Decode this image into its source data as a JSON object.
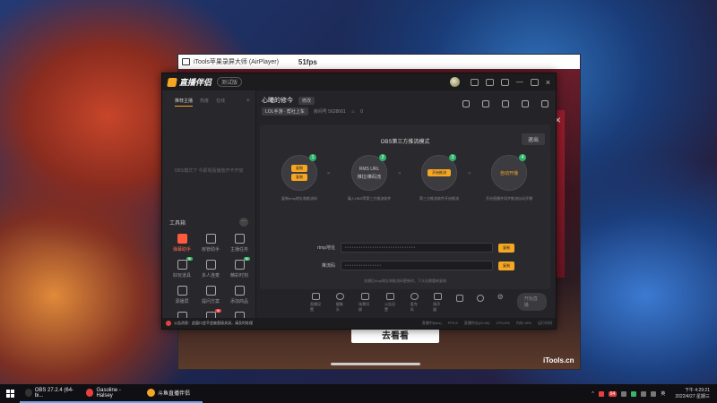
{
  "itools": {
    "title": "iTools苹果录屏大师 (AirPlayer)",
    "fps": "51fps",
    "go_look_button": "去看看",
    "brand": "iTools.cn"
  },
  "app": {
    "logo_text": "直播伴侣",
    "version": "测试版",
    "sidebar": {
      "tabs": [
        "推荐主播",
        "热度",
        "在线"
      ],
      "plus": "+",
      "empty_text": "OBS模式下 今即观看播放开不开放",
      "toolbox_title": "工具箱",
      "toolbox_more": "···",
      "tools": [
        {
          "label": "弹幕助手",
          "hot": true,
          "tag": ""
        },
        {
          "label": "房管助手",
          "hot": false,
          "tag": ""
        },
        {
          "label": "主播任务",
          "hot": false,
          "tag": ""
        },
        {
          "label": "好玩道具",
          "hot": false,
          "tag": "新"
        },
        {
          "label": "多人连麦",
          "hot": false,
          "tag": ""
        },
        {
          "label": "精彩时刻",
          "hot": false,
          "tag": "新"
        },
        {
          "label": "源播屏",
          "hot": false,
          "tag": ""
        },
        {
          "label": "提问方案",
          "hot": false,
          "tag": ""
        },
        {
          "label": "添加商品",
          "hot": false,
          "tag": ""
        },
        {
          "label": "",
          "hot": false,
          "tag": ""
        },
        {
          "label": "",
          "hot": false,
          "tag": "热"
        },
        {
          "label": "",
          "hot": false,
          "tag": ""
        }
      ]
    },
    "room": {
      "name": "心曦的修今",
      "edit": "修改",
      "category": "LOL手游 · 帮社上车",
      "room_id": "房间号  5628061",
      "fans": "0"
    },
    "obs": {
      "title": "OBS第三方推流模式",
      "exit": "退出",
      "steps": [
        {
          "num": "1",
          "chips": [
            "复制",
            "复制"
          ],
          "desc": "复制rtmp地址和推流码"
        },
        {
          "num": "2",
          "line1": "RMS URL",
          "line2": "推拉/推码流",
          "desc": "填入OBS等第三方推流软件"
        },
        {
          "num": "3",
          "chip": "开始推流",
          "desc": "第三方推流软件开启推流"
        },
        {
          "num": "4",
          "orange": "自动开播",
          "desc": "开启直播并同步推流自动开播"
        }
      ],
      "rtmp_label": "rtmp地址",
      "rtmp_value": "*******************************",
      "key_label": "推流码",
      "key_value": "****************",
      "copy": "复制",
      "hint": "关播后rtmp地址和推流码更新时，下次无需重新复制"
    },
    "bottom_tools": [
      "直播设置",
      "摄像头",
      "场景切换",
      "公告设置",
      "麦克风",
      "扬声器"
    ],
    "start_live": "开始直播",
    "status": {
      "notice": "公告消息：此窗口会不会被直接关闭，请及时处理",
      "stats": [
        "直播中(kb/s)",
        "FPS:0",
        "直播时长(00:00)",
        "CPU:6%",
        "内存:18%",
        "运行时间"
      ]
    }
  },
  "taskbar": {
    "tasks": [
      {
        "label": "OBS 27.2.4 (64-bi...",
        "color": "#333333"
      },
      {
        "label": "Gasoline - Halsey",
        "color": "#e84040"
      },
      {
        "label": "斗鱼直播伴侣",
        "color": "#f5a623"
      }
    ],
    "tray_badge": "64",
    "ime": "英",
    "time": "下午 4:29:21",
    "date": "2022/4/27 星期三"
  }
}
